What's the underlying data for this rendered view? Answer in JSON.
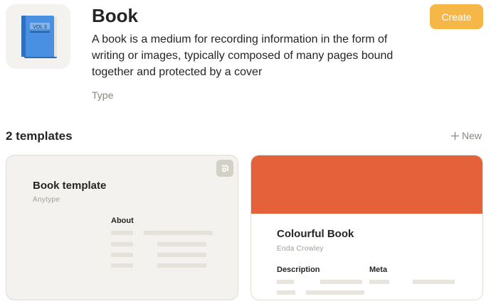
{
  "header": {
    "icon": "blue-book-icon",
    "book_icon_text": "VOL 3",
    "title": "Book",
    "description": "A book is a medium for recording information in the form of writing or images, typically composed of many pages bound together and protected by a cover",
    "type_label": "Type",
    "create_label": "Create"
  },
  "templates_section": {
    "title": "2 templates",
    "new_label": "New"
  },
  "templates": [
    {
      "title": "Book template",
      "author": "Anytype",
      "fields": [
        "About"
      ],
      "background": "#f3f2ee",
      "badge_icon": "anytype-logo-icon"
    },
    {
      "title": "Colourful Book",
      "author": "Enda Crowley",
      "fields": [
        "Description",
        "Meta"
      ],
      "cover_color": "#e4613a"
    }
  ],
  "colors": {
    "accent": "#f5b848",
    "muted_text": "#8a877d"
  }
}
